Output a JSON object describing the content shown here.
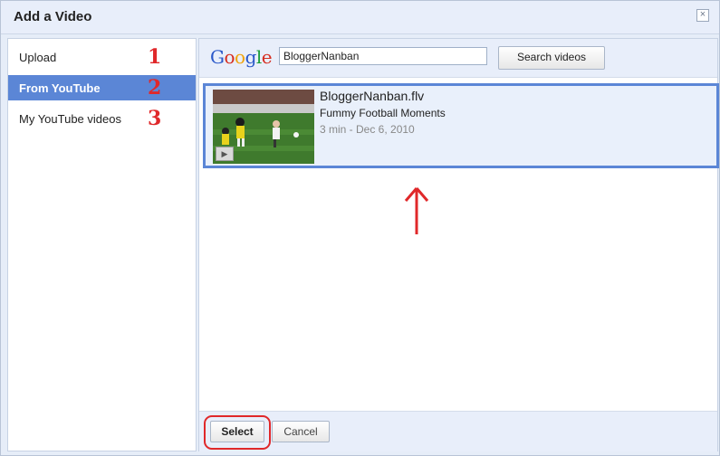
{
  "dialog": {
    "title": "Add a Video",
    "close_glyph": "×"
  },
  "sidebar": {
    "items": [
      {
        "label": "Upload",
        "number": "1",
        "active": false
      },
      {
        "label": "From YouTube",
        "number": "2",
        "active": true
      },
      {
        "label": "My YouTube videos",
        "number": "3",
        "active": false
      }
    ]
  },
  "search": {
    "logo": [
      "G",
      "o",
      "o",
      "g",
      "l",
      "e"
    ],
    "logo_colors": [
      "#2a58c9",
      "#d62d20",
      "#f0a30a",
      "#2a58c9",
      "#1a9c3a",
      "#d62d20"
    ],
    "query": "BloggerNanban",
    "button_label": "Search videos"
  },
  "results": [
    {
      "title": "BloggerNanban.flv",
      "description": "Fummy Football Moments",
      "meta": "3 min - Dec 6, 2010",
      "thumbnail_icon": "play-icon"
    }
  ],
  "annotations": {
    "arrow_icon": "up-arrow-icon",
    "accent_color": "#e0282a"
  },
  "footer": {
    "select_label": "Select",
    "cancel_label": "Cancel"
  },
  "colors": {
    "selection": "#5b86d6",
    "panel_bg": "#e8eefa"
  }
}
